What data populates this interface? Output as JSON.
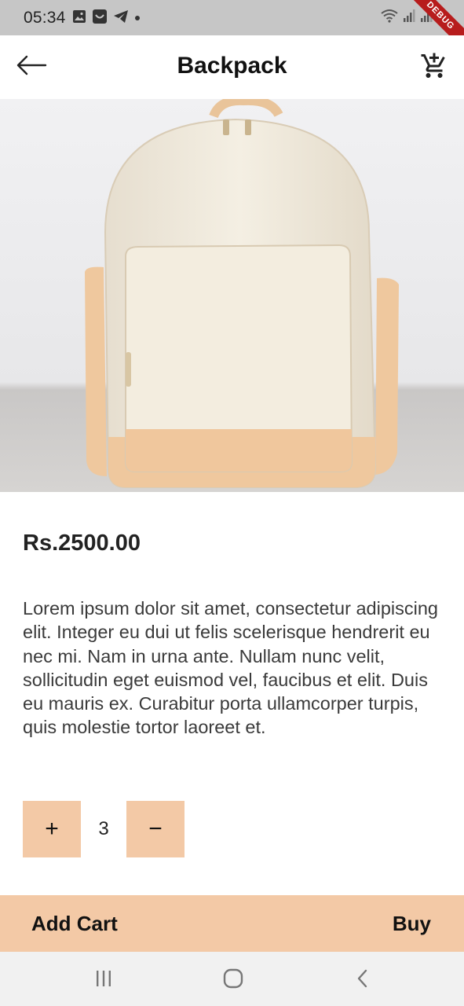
{
  "status_bar": {
    "time": "05:34",
    "left_icons": [
      "image-icon",
      "app-icon",
      "telegram-icon",
      "dot-icon"
    ],
    "right_icons": [
      "wifi-icon",
      "signal-icon",
      "signal-icon",
      "battery-icon"
    ],
    "debug_label": "DEBUG"
  },
  "app_bar": {
    "title": "Backpack",
    "back_icon": "arrow-back-icon",
    "cart_icon": "add-shopping-cart-icon"
  },
  "product": {
    "image_name": "backpack-image",
    "price": "Rs.2500.00",
    "description": "Lorem ipsum dolor sit amet, consectetur adipiscing elit. Integer eu dui ut felis scelerisque hendrerit eu nec mi. Nam in urna ante. Nullam nunc velit, sollicitudin eget euismod vel, faucibus et elit. Duis eu mauris ex. Curabitur porta ullamcorper turpis, quis molestie tortor laoreet et."
  },
  "quantity": {
    "increment_label": "+",
    "value": "3",
    "decrement_label": "−"
  },
  "actions": {
    "add_cart_label": "Add Cart",
    "buy_label": "Buy"
  },
  "colors": {
    "accent": "#f3c9a6",
    "status_bar": "#c6c6c6",
    "nav_bar": "#f1f1f1"
  }
}
